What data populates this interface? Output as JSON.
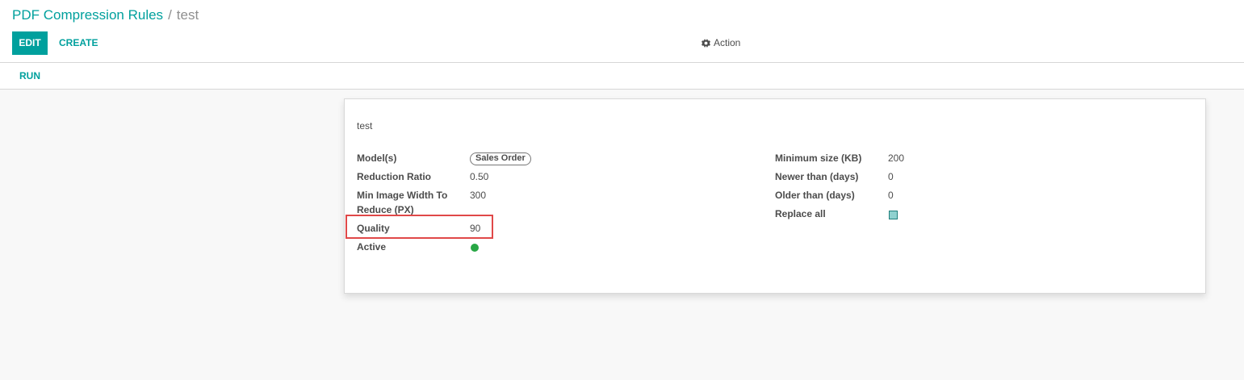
{
  "breadcrumb": {
    "parent": "PDF Compression Rules",
    "separator": "/",
    "current": "test"
  },
  "toolbar": {
    "edit_label": "EDIT",
    "create_label": "CREATE",
    "action_label": "Action",
    "action_icon": "gear-icon",
    "run_label": "RUN"
  },
  "record": {
    "name": "test",
    "left_fields": {
      "models": {
        "label": "Model(s)",
        "value": "Sales Order"
      },
      "reduction_ratio": {
        "label": "Reduction Ratio",
        "value": "0.50"
      },
      "min_image_width": {
        "label_line1": "Min Image Width To",
        "label_line2": "Reduce (PX)",
        "value": "300"
      },
      "quality": {
        "label": "Quality",
        "value": "90"
      },
      "active": {
        "label": "Active",
        "status_color": "#28a745"
      }
    },
    "right_fields": {
      "minimum_size": {
        "label": "Minimum size (KB)",
        "value": "200"
      },
      "newer_than": {
        "label": "Newer than (days)",
        "value": "0"
      },
      "older_than": {
        "label": "Older than (days)",
        "value": "0"
      },
      "replace_all": {
        "label": "Replace all",
        "checked": true
      }
    }
  },
  "colors": {
    "accent": "#00a09d",
    "highlight": "#e04848"
  }
}
